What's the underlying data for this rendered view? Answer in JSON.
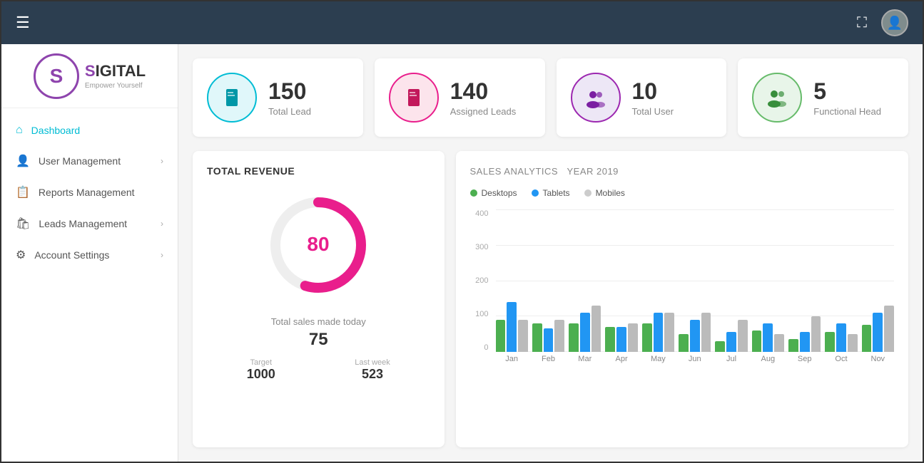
{
  "navbar": {
    "menu_icon": "☰",
    "expand_icon": "⛶",
    "avatar_icon": "👤"
  },
  "sidebar": {
    "logo": {
      "letter": "S",
      "title_pre": "",
      "title": "IGITAL",
      "subtitle": "Empower Yourself"
    },
    "items": [
      {
        "id": "dashboard",
        "label": "Dashboard",
        "icon": "⌂",
        "active": true,
        "has_arrow": false
      },
      {
        "id": "user-management",
        "label": "User Management",
        "icon": "👤",
        "active": false,
        "has_arrow": true
      },
      {
        "id": "reports-management",
        "label": "Reports Management",
        "icon": "📋",
        "active": false,
        "has_arrow": false
      },
      {
        "id": "leads-management",
        "label": "Leads Management",
        "icon": "🛍",
        "active": false,
        "has_arrow": true
      },
      {
        "id": "account-settings",
        "label": "Account Settings",
        "icon": "⚙",
        "active": false,
        "has_arrow": true
      }
    ]
  },
  "stats": [
    {
      "id": "total-lead",
      "number": "150",
      "label": "Total Lead",
      "color": "cyan",
      "icon": "📘"
    },
    {
      "id": "assigned-leads",
      "number": "140",
      "label": "Assigned Leads",
      "color": "pink",
      "icon": "📕"
    },
    {
      "id": "total-user",
      "number": "10",
      "label": "Total User",
      "color": "purple",
      "icon": "👥"
    },
    {
      "id": "functional-head",
      "number": "5",
      "label": "Functional Head",
      "color": "green",
      "icon": "👨‍👩‍👧"
    }
  ],
  "revenue": {
    "title": "TOTAL REVENUE",
    "donut_value": 80,
    "donut_max": 100,
    "donut_label": "80",
    "sales_label": "Total sales made today",
    "sales_value": "75",
    "target_label": "Target",
    "target_value": "1000",
    "lastweek_label": "Last week",
    "lastweek_value": "523"
  },
  "analytics": {
    "title": "SALES ANALYTICS",
    "year": "Year 2019",
    "legend": [
      {
        "id": "desktops",
        "label": "Desktops",
        "color": "#4caf50"
      },
      {
        "id": "tablets",
        "label": "Tablets",
        "color": "#2196f3"
      },
      {
        "id": "mobiles",
        "label": "Mobiles",
        "color": "#ccc"
      }
    ],
    "y_labels": [
      "400",
      "300",
      "200",
      "100",
      "0"
    ],
    "months": [
      {
        "label": "Jan",
        "desktops": 90,
        "tablets": 140,
        "mobiles": 90
      },
      {
        "label": "Feb",
        "desktops": 80,
        "tablets": 65,
        "mobiles": 90
      },
      {
        "label": "Mar",
        "desktops": 80,
        "tablets": 110,
        "mobiles": 130
      },
      {
        "label": "Apr",
        "desktops": 70,
        "tablets": 70,
        "mobiles": 80
      },
      {
        "label": "May",
        "desktops": 80,
        "tablets": 110,
        "mobiles": 110
      },
      {
        "label": "Jun",
        "desktops": 50,
        "tablets": 90,
        "mobiles": 110
      },
      {
        "label": "Jul",
        "desktops": 30,
        "tablets": 55,
        "mobiles": 90
      },
      {
        "label": "Aug",
        "desktops": 60,
        "tablets": 80,
        "mobiles": 50
      },
      {
        "label": "Sep",
        "desktops": 35,
        "tablets": 55,
        "mobiles": 100
      },
      {
        "label": "Oct",
        "desktops": 55,
        "tablets": 80,
        "mobiles": 50
      },
      {
        "label": "Nov",
        "desktops": 75,
        "tablets": 110,
        "mobiles": 130
      }
    ]
  }
}
